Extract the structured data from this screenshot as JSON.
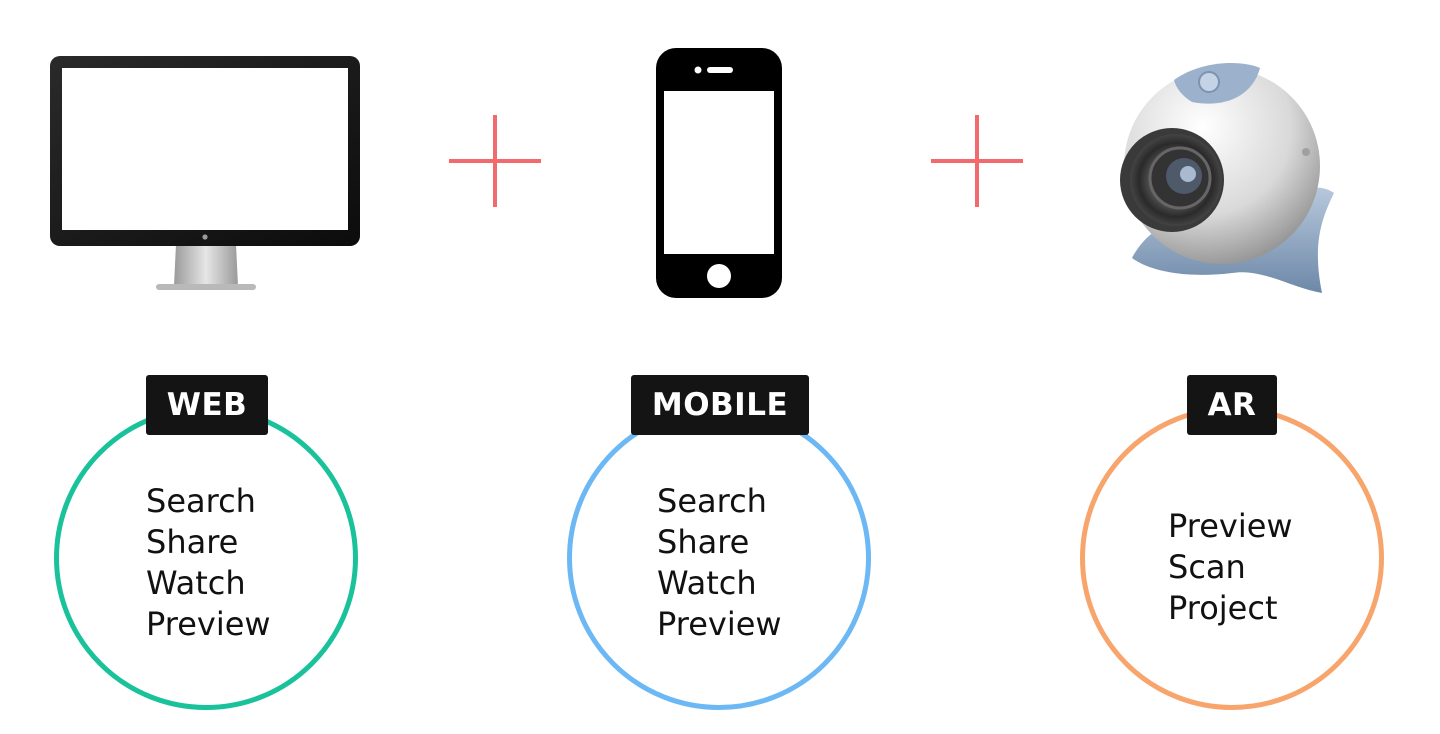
{
  "colors": {
    "plus": "#f06a6e",
    "web_ring": "#19c29a",
    "mobile_ring": "#6cb8f5",
    "ar_ring": "#f7a56c",
    "badge_bg": "#141414",
    "badge_text": "#ffffff"
  },
  "icons": {
    "web": "desktop-monitor-icon",
    "mobile": "smartphone-icon",
    "ar": "webcam-icon",
    "separator": "plus-icon"
  },
  "columns": [
    {
      "label": "WEB",
      "features": [
        "Search",
        "Share",
        "Watch",
        "Preview"
      ]
    },
    {
      "label": "MOBILE",
      "features": [
        "Search",
        "Share",
        "Watch",
        "Preview"
      ]
    },
    {
      "label": "AR",
      "features": [
        "Preview",
        "Scan",
        "Project"
      ]
    }
  ]
}
